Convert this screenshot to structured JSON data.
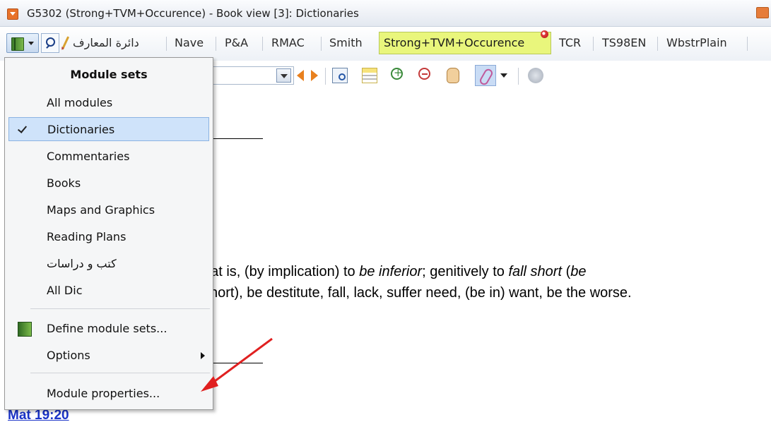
{
  "window": {
    "title": "G5302 (Strong+TVM+Occurence) - Book view [3]: Dictionaries"
  },
  "tabs": {
    "arabic_tab": "دائرة المعارف",
    "items": [
      "Nave",
      "P&A",
      "RMAC",
      "Smith"
    ],
    "active": "Strong+TVM+Occurence",
    "after": [
      "TCR",
      "TS98EN",
      "WbstrPlain"
    ]
  },
  "menu": {
    "header": "Module sets",
    "sets": [
      "All modules",
      "Dictionaries",
      "Commentaries",
      "Books",
      "Maps and Graphics",
      "Reading Plans",
      "كتب و دراسات",
      "All Dic"
    ],
    "checked": "Dictionaries",
    "define": "Define module sets...",
    "options": "Options",
    "properties": "Module properties..."
  },
  "content": {
    "line1_pre": "hat is, (by implication) to ",
    "line1_em1": "be inferior",
    "line1_mid": "; genitively to ",
    "line1_em2": "fall short",
    "line1_post": " (",
    "line1_em3": "be",
    "line2": "short), be destitute, fall, lack, suffer need, (be in) want, be the worse.",
    "reference": "Mat 19:20"
  },
  "colors": {
    "active_tab": "#e9f67c",
    "link": "#1a33c8",
    "annotation_arrow": "#e02020",
    "menu_highlight": "#cfe3fa"
  }
}
